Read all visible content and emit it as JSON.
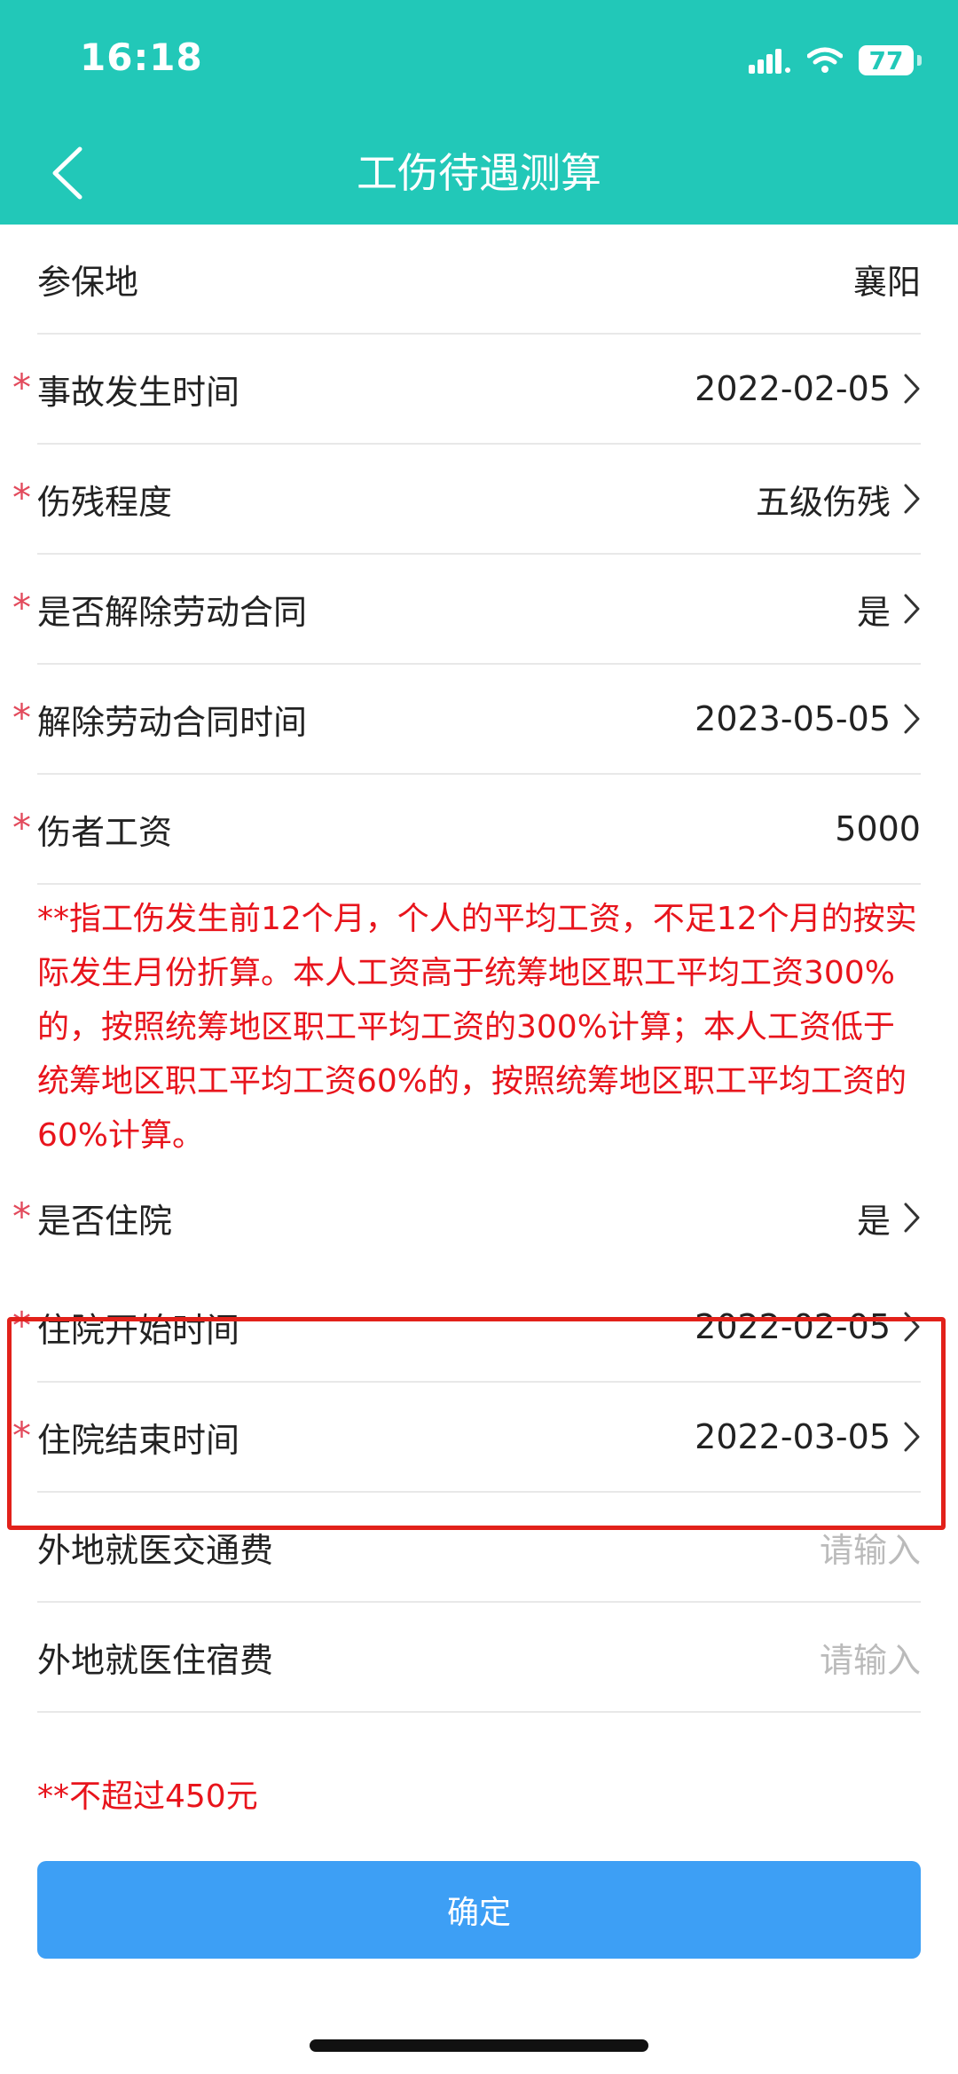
{
  "status_bar": {
    "time": "16:18",
    "battery": "77"
  },
  "header": {
    "title": "工伤待遇测算"
  },
  "rows": [
    {
      "label": "参保地",
      "value": "襄阳",
      "required": false,
      "arrow": false
    },
    {
      "label": "事故发生时间",
      "value": "2022-02-05",
      "required": true,
      "arrow": true
    },
    {
      "label": "伤残程度",
      "value": "五级伤残",
      "required": true,
      "arrow": true
    },
    {
      "label": "是否解除劳动合同",
      "value": "是",
      "required": true,
      "arrow": true
    },
    {
      "label": "解除劳动合同时间",
      "value": "2023-05-05",
      "required": true,
      "arrow": true
    },
    {
      "label": "伤者工资",
      "value": "5000",
      "required": true,
      "arrow": false
    }
  ],
  "salary_note": "**指工伤发生前12个月，个人的平均工资，不足12个月的按实际发生月份折算。本人工资高于统筹地区职工平均工资300%的，按照统筹地区职工平均工资的300%计算；本人工资低于统筹地区职工平均工资60%的，按照统筹地区职工平均工资的60%计算。",
  "rows2": [
    {
      "label": "是否住院",
      "value": "是",
      "required": true,
      "arrow": true
    },
    {
      "label": "住院开始时间",
      "value": "2022-02-05",
      "required": true,
      "arrow": true
    },
    {
      "label": "住院结束时间",
      "value": "2022-03-05",
      "required": true,
      "arrow": true
    }
  ],
  "inputs": [
    {
      "label": "外地就医交通费",
      "placeholder": "请输入"
    },
    {
      "label": "外地就医住宿费",
      "placeholder": "请输入"
    }
  ],
  "limit_note": "**不超过450元",
  "confirm_label": "确定",
  "required_mark": "*",
  "colors": {
    "header": "#22c8b8",
    "note_red": "#e8141c",
    "button_blue": "#3d9ff5",
    "highlight_red": "#e2211a"
  }
}
